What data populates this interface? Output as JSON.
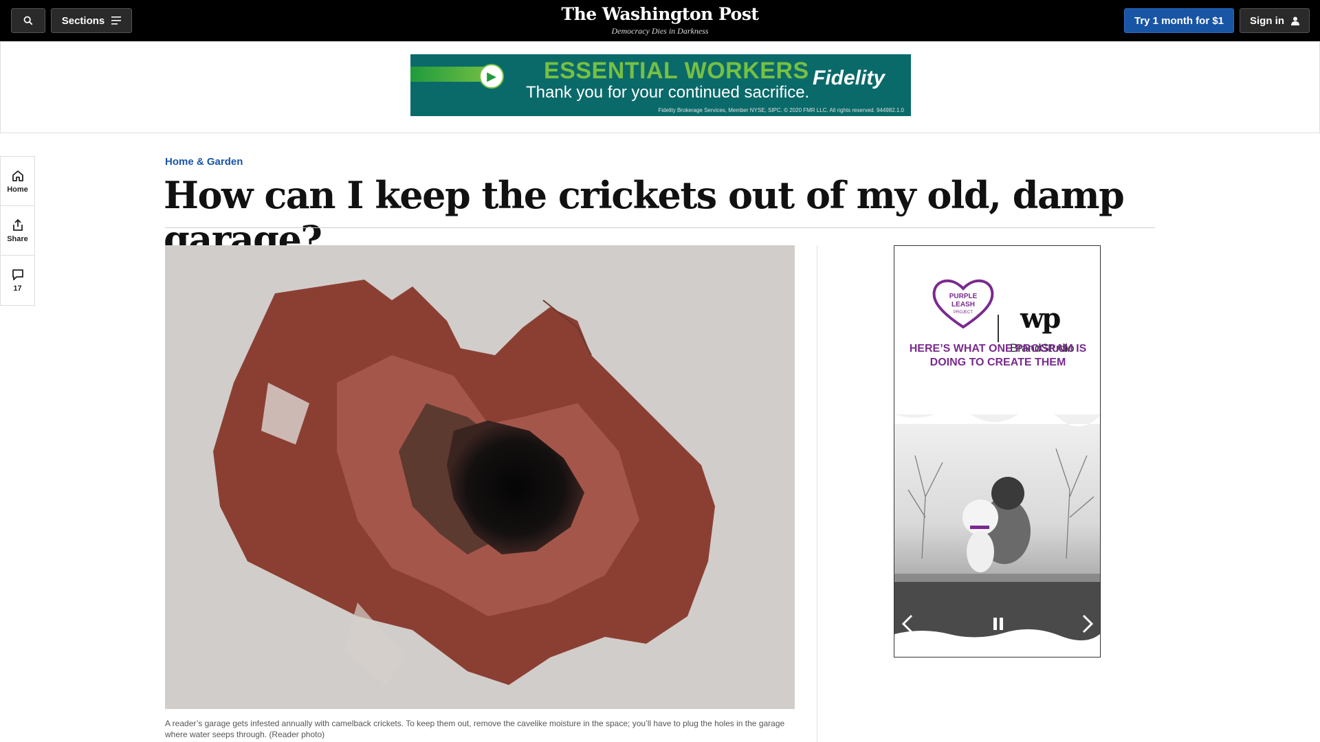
{
  "header": {
    "search_icon": "search-icon",
    "sections_label": "Sections",
    "logo": "The Washington Post",
    "tagline": "Democracy Dies in Darkness",
    "subscribe_label": "Try 1 month for $1",
    "signin_label": "Sign in"
  },
  "top_ad": {
    "headline": "ESSENTIAL WORKERS",
    "subline": "Thank you for your continued sacrifice.",
    "brand": "Fidelity",
    "fine_print": "Fidelity Brokerage Services, Member NYSE, SIPC. © 2020 FMR LLC. All rights reserved. 944982.1.0"
  },
  "rail": {
    "home_label": "Home",
    "share_label": "Share",
    "comments_count": "17"
  },
  "article": {
    "kicker": "Home & Garden",
    "title": "How can I keep the crickets out of my old, damp garage?",
    "caption": "A reader’s garage gets infested annually with camelback crickets. To keep them out, remove the cavelike moisture in the space; you’ll have to plug the holes in the garage where water seeps through. (Reader photo)"
  },
  "side_ad": {
    "partner_logo_text": "PURPLE LEASH PROJECT",
    "wp_mark": "wp",
    "brandstudio": "BrandStudio",
    "promo": "HERE’S WHAT ONE PROGRAM IS DOING TO CREATE THEM"
  },
  "colors": {
    "accent_blue": "#1955a5",
    "promo_purple": "#7a2a8e",
    "ad_teal": "#0a6a6a",
    "ad_green": "#76c043"
  }
}
